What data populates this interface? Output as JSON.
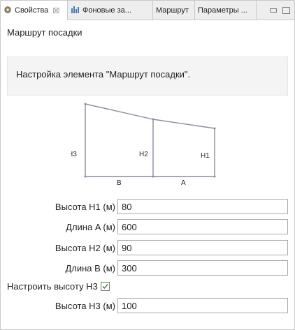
{
  "tabs": [
    {
      "label": "Свойства",
      "icon": "gear-icon",
      "close": "☒"
    },
    {
      "label": "Фоновые за...",
      "icon": "bar-chart-icon"
    },
    {
      "label": "Маршрут"
    },
    {
      "label": "Параметры ..."
    }
  ],
  "section_title": "Маршрут посадки",
  "info_text": "Настройка элемента \"Маршрут посадки\".",
  "diagram": {
    "label_h3": "H3",
    "label_h2": "H2",
    "label_h1": "H1",
    "label_b": "B",
    "label_a": "A"
  },
  "fields": {
    "h1": {
      "label": "Высота H1 (м)",
      "value": "80"
    },
    "a": {
      "label": "Длина A (м)",
      "value": "600"
    },
    "h2": {
      "label": "Высота H2 (м)",
      "value": "90"
    },
    "b": {
      "label": "Длина B (м)",
      "value": "300"
    },
    "h3_toggle": {
      "label": "Настроить высоту H3",
      "checked": true
    },
    "h3": {
      "label": "Высота H3 (м)",
      "value": "100"
    }
  }
}
